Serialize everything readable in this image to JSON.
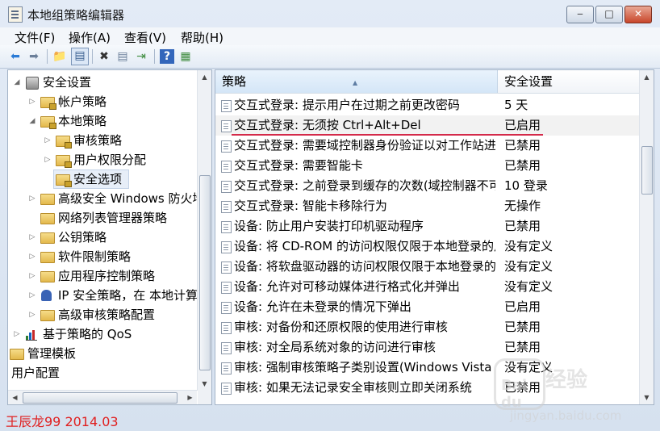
{
  "window": {
    "title": "本地组策略编辑器"
  },
  "menu": [
    "文件(F)",
    "操作(A)",
    "查看(V)",
    "帮助(H)"
  ],
  "toolbar_icons": [
    "back-arrow-icon",
    "forward-arrow-icon",
    "up-folder-icon",
    "show-hide-tree-icon",
    "delete-icon",
    "properties-icon",
    "export-list-icon",
    "help-icon",
    "extended-view-icon"
  ],
  "tree": [
    {
      "label": "安全设置",
      "expanded": true
    },
    {
      "label": "帐户策略",
      "expanded": false
    },
    {
      "label": "本地策略",
      "expanded": true
    },
    {
      "label": "审核策略",
      "expanded": false
    },
    {
      "label": "用户权限分配",
      "expanded": false
    },
    {
      "label": "安全选项",
      "selected": true
    },
    {
      "label": "高级安全 Windows 防火墙",
      "expanded": false
    },
    {
      "label": "网络列表管理器策略"
    },
    {
      "label": "公钥策略",
      "expanded": false
    },
    {
      "label": "软件限制策略",
      "expanded": false
    },
    {
      "label": "应用程序控制策略",
      "expanded": false
    },
    {
      "label": "IP 安全策略，在 本地计算机",
      "expanded": false
    },
    {
      "label": "高级审核策略配置",
      "expanded": false
    },
    {
      "label": "基于策略的 QoS",
      "expanded": false
    },
    {
      "label": "管理模板"
    },
    {
      "label": "用户配置"
    }
  ],
  "table": {
    "columns": [
      "策略",
      "安全设置"
    ],
    "rows": [
      {
        "name": "交互式登录: 提示用户在过期之前更改密码",
        "value": "5 天"
      },
      {
        "name": "交互式登录: 无须按 Ctrl+Alt+Del",
        "value": "已启用"
      },
      {
        "name": "交互式登录: 需要域控制器身份验证以对工作站进行解锁",
        "value": "已禁用"
      },
      {
        "name": "交互式登录: 需要智能卡",
        "value": "已禁用"
      },
      {
        "name": "交互式登录: 之前登录到缓存的次数(域控制器不可用时)",
        "value": "10 登录"
      },
      {
        "name": "交互式登录: 智能卡移除行为",
        "value": "无操作"
      },
      {
        "name": "设备: 防止用户安装打印机驱动程序",
        "value": "已禁用"
      },
      {
        "name": "设备: 将 CD-ROM 的访问权限仅限于本地登录的用户",
        "value": "没有定义"
      },
      {
        "name": "设备: 将软盘驱动器的访问权限仅限于本地登录的用户",
        "value": "没有定义"
      },
      {
        "name": "设备: 允许对可移动媒体进行格式化并弹出",
        "value": "没有定义"
      },
      {
        "name": "设备: 允许在未登录的情况下弹出",
        "value": "已启用"
      },
      {
        "name": "审核: 对备份和还原权限的使用进行审核",
        "value": "已禁用"
      },
      {
        "name": "审核: 对全局系统对象的访问进行审核",
        "value": "已禁用"
      },
      {
        "name": "审核: 强制审核策略子类别设置(Windows Vista 或更高版本)",
        "value": "没有定义"
      },
      {
        "name": "审核: 如果无法记录安全审核则立即关闭系统",
        "value": "已禁用"
      }
    ],
    "highlighted_index": 1
  },
  "watermark": {
    "author": "王辰龙99 2014.03",
    "brand": "Bai du",
    "brand_cn": "经验",
    "url": "jingyan.baidu.com"
  },
  "colors": {
    "underline": "#d42a4a",
    "watermark": "#e02020"
  }
}
